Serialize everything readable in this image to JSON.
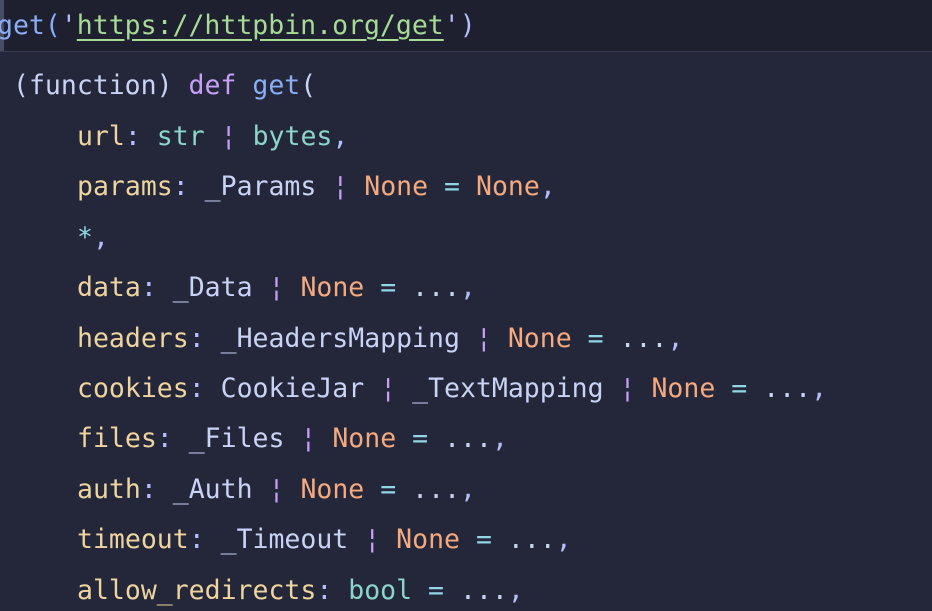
{
  "editor": {
    "call_prefix": "get(",
    "quote_open": "'",
    "url": "https://httpbin.org/get",
    "quote_close": "'",
    "call_suffix": ")"
  },
  "hover": {
    "kind": "(function)",
    "def_keyword": "def",
    "function_name": "get",
    "open_paren": "(",
    "params": [
      {
        "name": "url",
        "sep": ": ",
        "types": [
          "str",
          "bytes"
        ],
        "default": "",
        "trail": ","
      },
      {
        "name": "params",
        "sep": ": ",
        "types": [
          "_Params",
          "None"
        ],
        "default": "None",
        "trail": ","
      },
      {
        "name": "*",
        "sep": "",
        "types": [],
        "default": "",
        "trail": ","
      },
      {
        "name": "data",
        "sep": ": ",
        "types": [
          "_Data",
          "None"
        ],
        "default": "...",
        "trail": ","
      },
      {
        "name": "headers",
        "sep": ": ",
        "types": [
          "_HeadersMapping",
          "None"
        ],
        "default": "...",
        "trail": ","
      },
      {
        "name": "cookies",
        "sep": ": ",
        "types": [
          "CookieJar",
          "_TextMapping",
          "None"
        ],
        "default": "...",
        "trail": ","
      },
      {
        "name": "files",
        "sep": ": ",
        "types": [
          "_Files",
          "None"
        ],
        "default": "...",
        "trail": ","
      },
      {
        "name": "auth",
        "sep": ": ",
        "types": [
          "_Auth",
          "None"
        ],
        "default": "...",
        "trail": ","
      },
      {
        "name": "timeout",
        "sep": ": ",
        "types": [
          "_Timeout",
          "None"
        ],
        "default": "...",
        "trail": ","
      },
      {
        "name": "allow_redirects",
        "sep": ": ",
        "types": [
          "bool"
        ],
        "default": "...",
        "trail": ","
      }
    ],
    "pipe_char": "¦",
    "equals": "="
  }
}
